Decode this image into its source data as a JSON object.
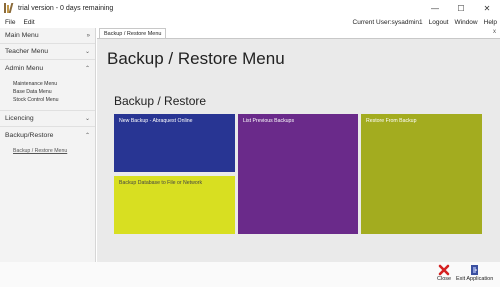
{
  "window": {
    "title": "trial version - 0 days remaining",
    "minimize": "—",
    "maximize": "☐",
    "close": "✕"
  },
  "menubar": {
    "file": "File",
    "edit": "Edit",
    "current_user": "Current User:sysadmin1",
    "logout": "Logout",
    "window": "Window",
    "help": "Help"
  },
  "sidebar": {
    "main_menu": "Main Menu",
    "teacher_menu": "Teacher Menu",
    "admin_menu": "Admin Menu",
    "admin_items": [
      "Maintenance Menu",
      "Base Data Menu",
      "Stock Control Menu"
    ],
    "licencing": "Licencing",
    "backup_restore": "Backup/Restore",
    "backup_items": [
      "Backup / Restore Menu"
    ]
  },
  "tab": {
    "label": "Backup / Restore Menu",
    "close": "x"
  },
  "main": {
    "page_title": "Backup / Restore Menu",
    "section_title": "Backup / Restore",
    "tiles": {
      "new_backup": "New Backup - Abraquest Online",
      "list_backups": "List Previous Backups",
      "restore": "Restore From Backup",
      "backup_db": "Backup Database to File or Network"
    }
  },
  "footer": {
    "close": "Close",
    "exit": "Exit Application"
  },
  "colors": {
    "tile_new": "#283593",
    "tile_list": "#6a2a8a",
    "tile_restore": "#a3ac1f",
    "tile_db": "#d8df21"
  }
}
